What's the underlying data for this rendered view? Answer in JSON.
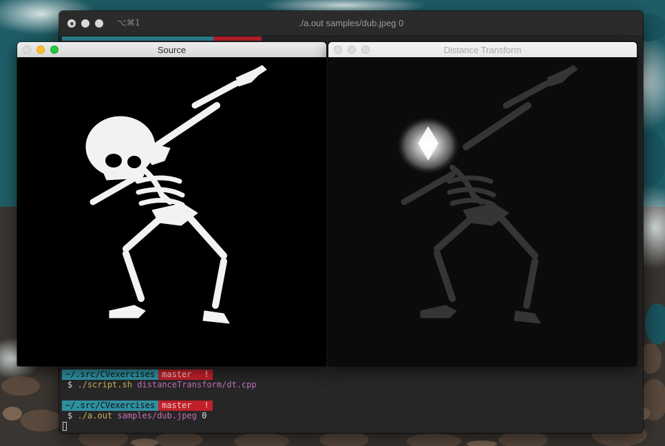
{
  "terminal": {
    "shortcut": "⌥⌘1",
    "title": "./a.out samples/dub.jpeg 0",
    "sessions": [
      {
        "path": "~/.src/CVexercises",
        "branch": "master",
        "flag": "!",
        "command": "./script.sh",
        "args": "distanceTransform/dt.cpp",
        "number": ""
      },
      {
        "path": "~/.src/CVexercises",
        "branch": "master",
        "flag": "!",
        "command": "./a.out",
        "args": "samples/dub.jpeg",
        "number": "0"
      }
    ],
    "prompt_symbol": "$"
  },
  "windows": {
    "source": {
      "title": "Source"
    },
    "distance": {
      "title": "Distance Transform"
    }
  },
  "colors": {
    "path_segment": "#2e8fa0",
    "branch_segment": "#c0202a",
    "terminal_bg": "#262626"
  }
}
